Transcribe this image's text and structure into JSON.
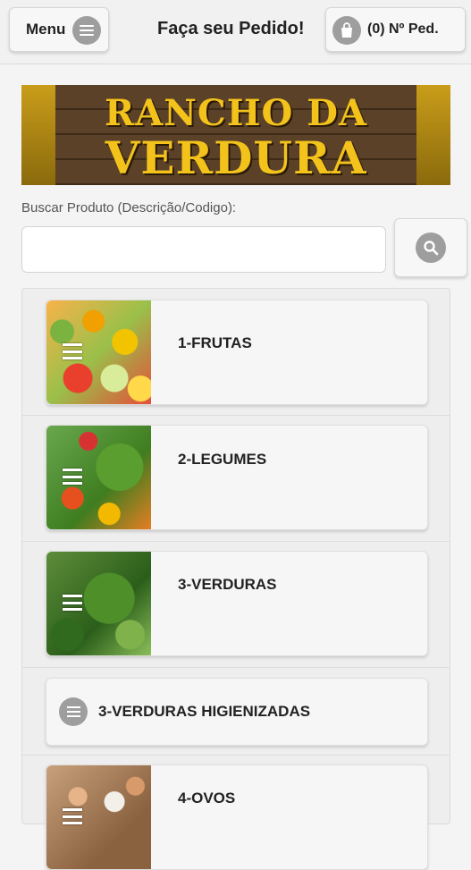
{
  "header": {
    "menu_label": "Menu",
    "title": "Faça seu Pedido!",
    "cart_label": "(0) Nº Ped."
  },
  "banner": {
    "line1": "RANCHO DA",
    "line2": "VERDURA"
  },
  "search": {
    "label": "Buscar Produto (Descrição/Codigo):",
    "value": "",
    "placeholder": ""
  },
  "categories": [
    {
      "label": "1-FRUTAS",
      "icon": "list-icon"
    },
    {
      "label": "2-LEGUMES",
      "icon": "list-icon"
    },
    {
      "label": "3-VERDURAS",
      "icon": "list-icon"
    },
    {
      "label": "3-VERDURAS HIGIENIZADAS",
      "icon": "list-icon"
    },
    {
      "label": "4-OVOS",
      "icon": "list-icon"
    }
  ],
  "colors": {
    "icon_gray": "#9e9e9e",
    "banner_gold": "#f3c31c",
    "banner_wood": "#4a3420"
  }
}
